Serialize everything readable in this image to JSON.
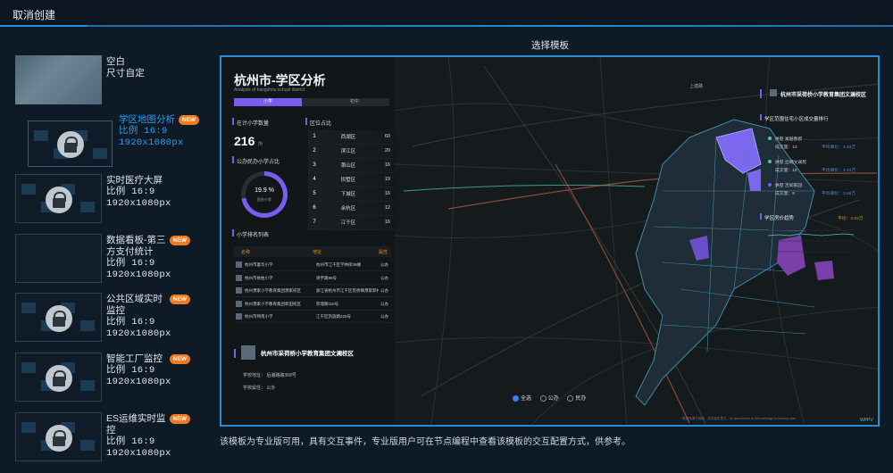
{
  "header": {
    "cancel_label": "取消创建"
  },
  "main": {
    "section_title": "选择模板",
    "notice": "该模板为专业版可用，具有交互事件，专业版用户可在节点编程中查看该模板的交互配置方式，供参考。"
  },
  "colors": {
    "accent": "#1e8fd6",
    "active_text": "#2c9bf0",
    "badge": "#f07a22",
    "background": "#0e1a26"
  },
  "templates": [
    {
      "title": "空白",
      "line2": "尺寸自定",
      "line3": "",
      "line4": "",
      "badge": "",
      "locked": false,
      "active": false
    },
    {
      "title": "学区地图分析",
      "line2": "比例 16:9",
      "line3": "1920x1080px",
      "line4": "",
      "badge": "NEW",
      "locked": true,
      "active": true
    },
    {
      "title": "实时医疗大屏",
      "line2": "比例 16:9",
      "line3": "1920x1080px",
      "line4": "",
      "badge": "",
      "locked": true,
      "active": false
    },
    {
      "title": "数据看板-第三方支付统计",
      "line2": "比例 16:9",
      "line3": "1920x1080px",
      "line4": "",
      "badge": "NEW",
      "locked": false,
      "active": false
    },
    {
      "title": "公共区域实时监控",
      "line2": "比例 16:9",
      "line3": "1920x1080px",
      "line4": "",
      "badge": "NEW",
      "locked": true,
      "active": false
    },
    {
      "title": "智能工厂监控",
      "line2": "比例 16:9",
      "line3": "1920x1080px",
      "line4": "",
      "badge": "NEW",
      "locked": true,
      "active": false
    },
    {
      "title": "ES运维实时监控",
      "line2": "比例 16:9",
      "line3": "1920x1080px",
      "line4": "",
      "badge": "NEW",
      "locked": true,
      "active": false
    }
  ],
  "icons": {
    "lock": "lock-icon"
  },
  "preview": {
    "title": "杭州市-学区分析",
    "subtitle": "Analysis of hangzhou school district",
    "seg_on": "小学",
    "seg_off": "初中",
    "count_label": "在计小学数量",
    "count_value": "216",
    "count_unit": "所",
    "ratio_label": "公办民办小学占比",
    "ratio_value": "19.9 %",
    "ratio_caption": "民办小学",
    "ratio_fraction": 0.72,
    "district_label": "区位占比",
    "districts": [
      {
        "rank": "1",
        "name": "西湖区",
        "count": "60"
      },
      {
        "rank": "2",
        "name": "滨江区",
        "count": "20"
      },
      {
        "rank": "3",
        "name": "萧山区",
        "count": "16"
      },
      {
        "rank": "4",
        "name": "拱墅区",
        "count": "19"
      },
      {
        "rank": "5",
        "name": "下城区",
        "count": "16"
      },
      {
        "rank": "6",
        "name": "余杭区",
        "count": "12"
      },
      {
        "rank": "7",
        "name": "江干区",
        "count": "16"
      }
    ],
    "list_label": "小学排名列表",
    "list_headers": [
      "名称",
      "地址",
      "属性"
    ],
    "schools": [
      {
        "name": "杭州市童华小学",
        "addr": "杭州市江干区学林街36幢",
        "type": "公办"
      },
      {
        "name": "杭州市依柏小学",
        "addr": "谢宇路99号",
        "type": "公办"
      },
      {
        "name": "杭州濮家小学教育集团濮家校区",
        "addr": "浙江省杭州市江干区笕桥镇濮家新村北二幢",
        "type": "公办"
      },
      {
        "name": "杭州濮家小学教育集团新田校区",
        "addr": "凯瑞路110号",
        "type": "公办"
      },
      {
        "name": "杭州市熙南小学",
        "addr": "江干区凯旋路228号",
        "type": "公办"
      }
    ],
    "card": {
      "title": "杭州市采荷桥小学教育集团文澜校区",
      "address": "学校地址： 后潮路路368号",
      "type": "学校属性： 公办"
    },
    "right": {
      "school_title": "杭州市采荷桥小学教育集团文澜校区",
      "rank_label": "学区范围住宅小区成交量排行",
      "items": [
        {
          "name": "拱墅 富越香郡",
          "deals": "成交量：14",
          "price": "平均单价：4.33万"
        },
        {
          "name": "拱墅 丝绸文澜苑",
          "deals": "成交量：10",
          "price": "平均单价：4.23万"
        },
        {
          "name": "拱墅 吉如家园",
          "deals": "成交量：8",
          "price": "平均单价：3.66万"
        }
      ],
      "trend_label": "学区房价趋势",
      "trend_avg": "平均：3.93万"
    },
    "legend": [
      "全选",
      "公办",
      "民办"
    ],
    "footer": "*数据来源于网络，并无真实意义，All data shown on this webpage is mockup data.",
    "brand": "WPPV"
  }
}
